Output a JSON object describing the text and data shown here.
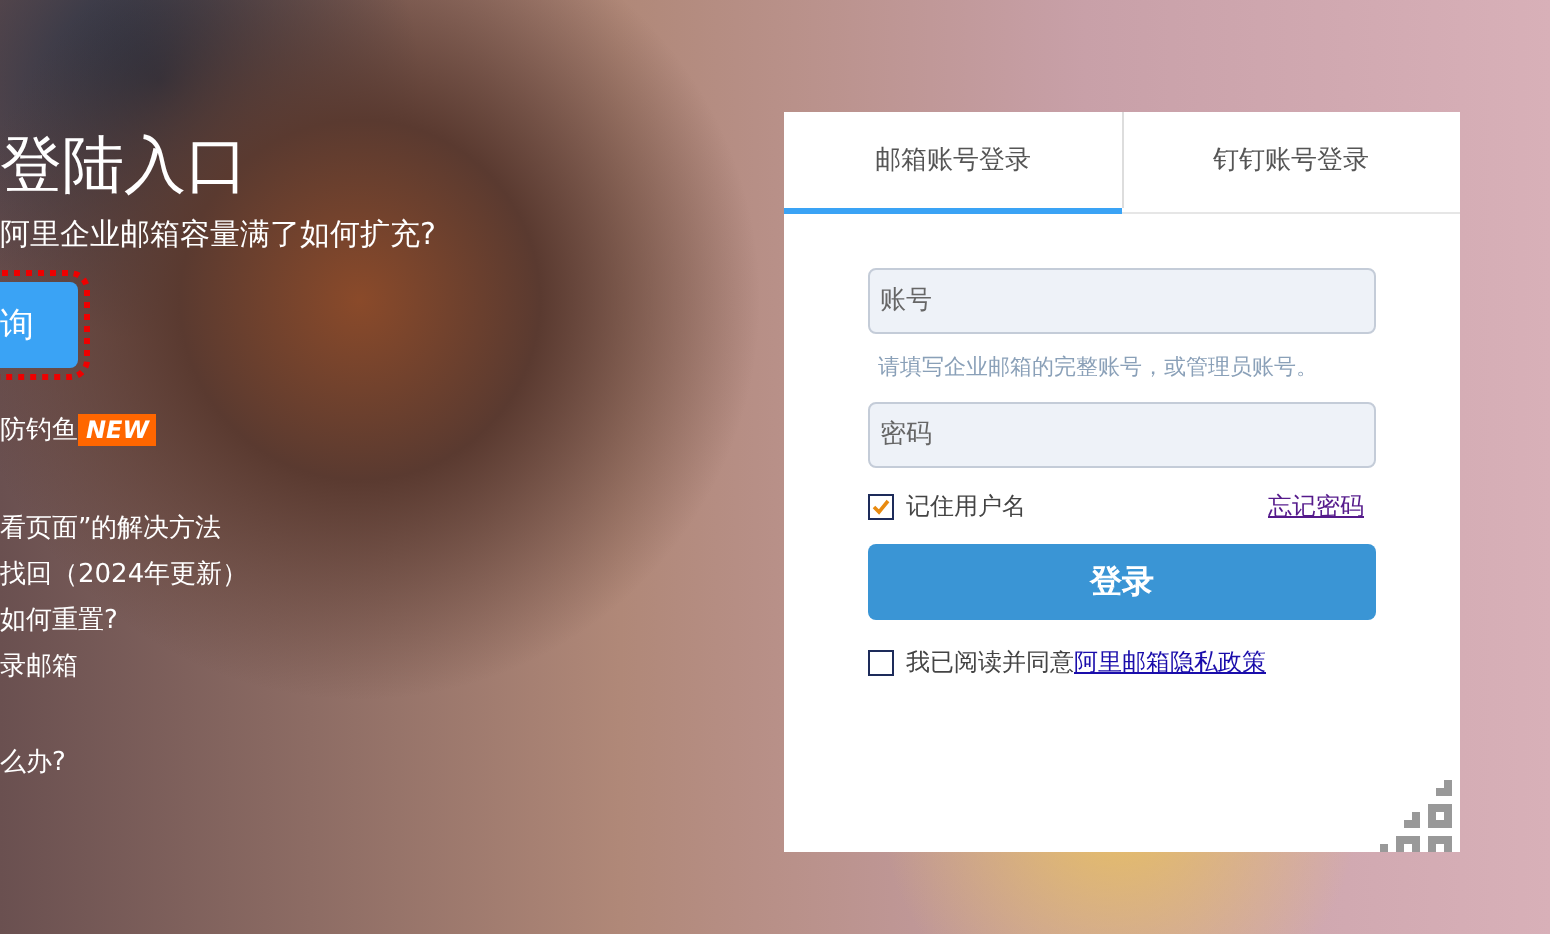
{
  "promo": {
    "title": "登陆入口",
    "question": "阿里企业邮箱容量满了如何扩充?",
    "button": "询",
    "news": {
      "text": "防钓鱼",
      "badge": "NEW"
    },
    "links": [
      "看页面”的解决方法",
      "找回（2024年更新）",
      "如何重置?",
      "录邮箱"
    ],
    "last_link": "么办?"
  },
  "login": {
    "tabs": [
      {
        "label": "邮箱账号登录",
        "selected": true
      },
      {
        "label": "钉钉账号登录",
        "selected": false
      }
    ],
    "account": {
      "placeholder": "账号"
    },
    "hint": "请填写企业邮箱的完整账号，或管理员账号。",
    "password": {
      "placeholder": "密码"
    },
    "remember": {
      "label": "记住用户名",
      "checked": true
    },
    "forgot": "忘记密码",
    "submit": "登录",
    "agree": {
      "label": "我已阅读并同意",
      "link": "阿里邮箱隐私政策",
      "checked": false
    }
  }
}
